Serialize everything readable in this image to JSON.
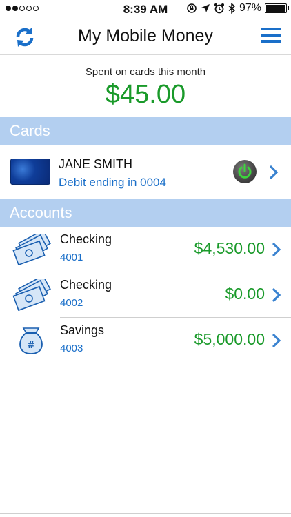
{
  "status_bar": {
    "time": "8:39 AM",
    "battery": "97%",
    "battery_level": 0.97,
    "signal_dots_filled": 2,
    "signal_dots_total": 5
  },
  "header": {
    "title": "My Mobile Money",
    "left_icon": "refresh-icon",
    "right_icon": "hamburger-menu-icon"
  },
  "summary": {
    "label": "Spent on cards this month",
    "amount": "$45.00"
  },
  "cards_section": {
    "title": "Cards",
    "items": [
      {
        "name": "JANE SMITH",
        "subtitle": "Debit ending in 0004",
        "power_icon": "power-toggle-icon"
      }
    ]
  },
  "accounts_section": {
    "title": "Accounts",
    "items": [
      {
        "name": "Checking",
        "number": "4001",
        "amount": "$4,530.00",
        "icon": "cash-stack-icon"
      },
      {
        "name": "Checking",
        "number": "4002",
        "amount": "$0.00",
        "icon": "cash-stack-icon"
      },
      {
        "name": "Savings",
        "number": "4003",
        "amount": "$5,000.00",
        "icon": "money-bag-icon"
      }
    ]
  },
  "colors": {
    "accent_blue": "#1a6fc9",
    "amount_green": "#1a9a2a",
    "section_bg": "#b3cff0"
  }
}
